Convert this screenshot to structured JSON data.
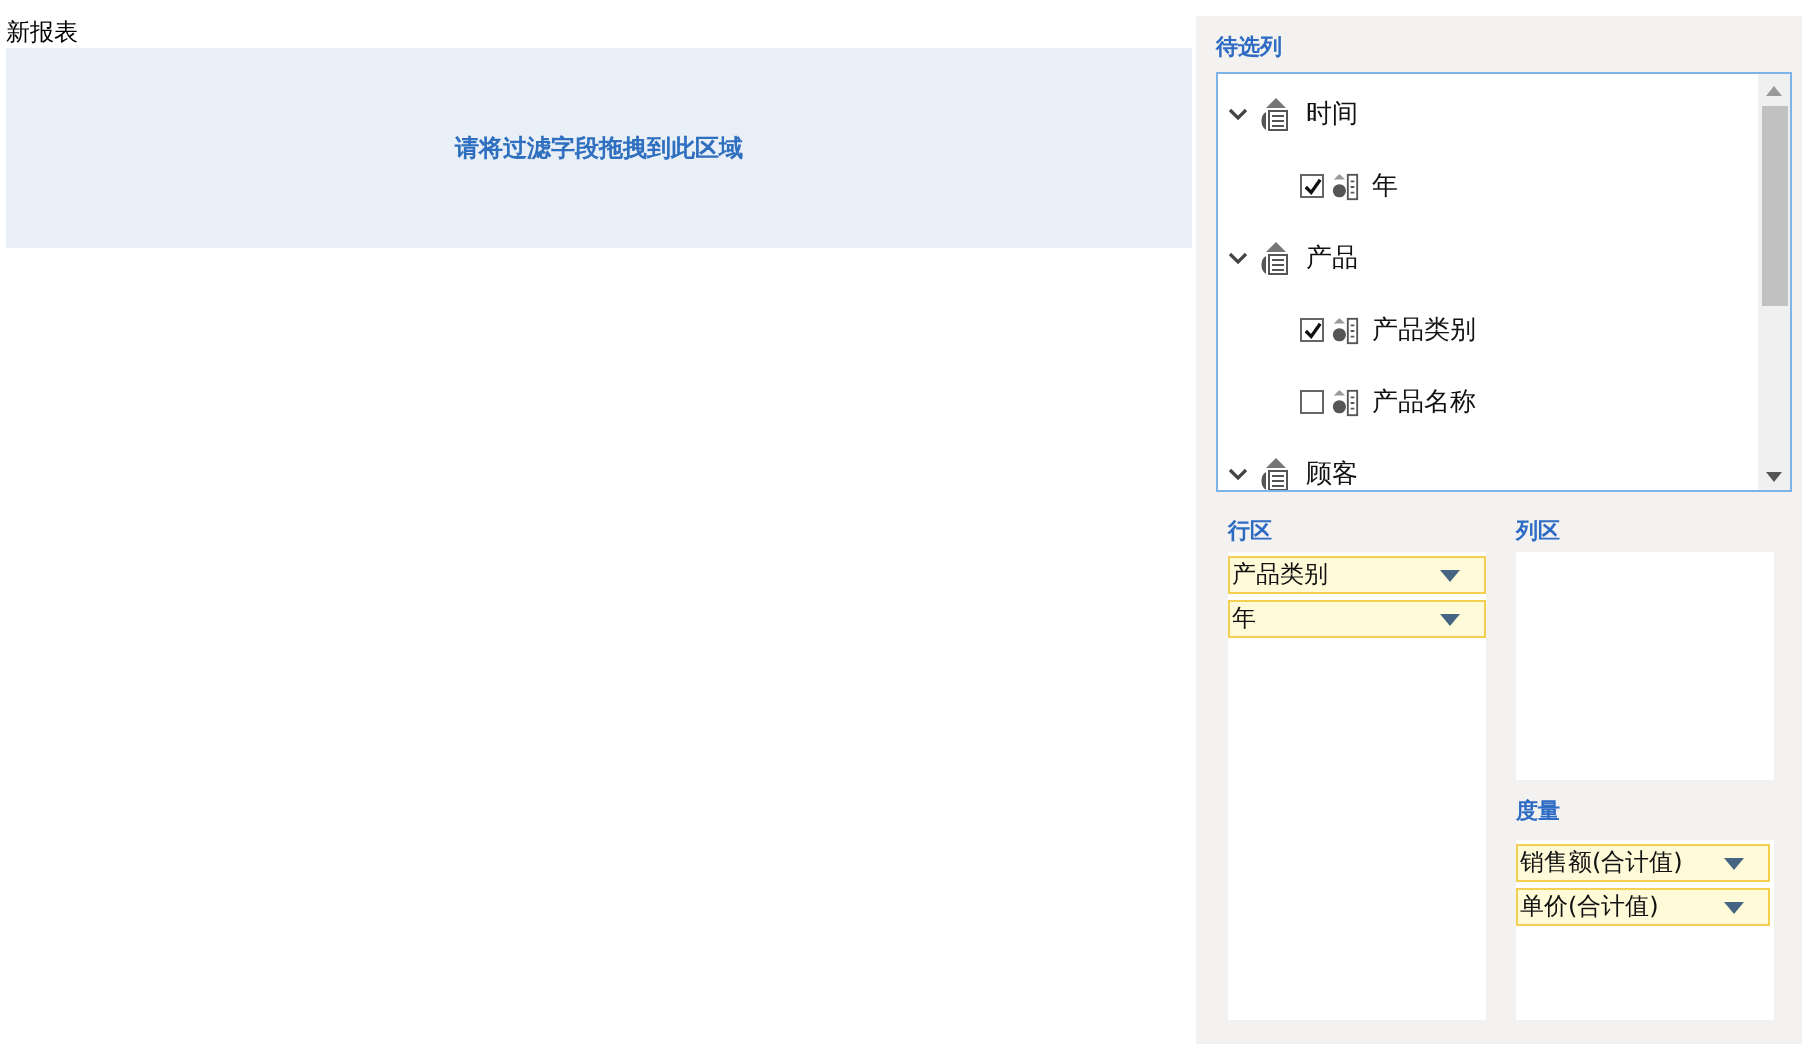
{
  "report": {
    "title": "新报表",
    "filter_hint": "请将过滤字段拖拽到此区域"
  },
  "field_list": {
    "title": "待选列",
    "items": [
      {
        "label": "时间",
        "expanded": true,
        "children": [
          {
            "label": "年",
            "checked": true
          }
        ]
      },
      {
        "label": "产品",
        "expanded": true,
        "children": [
          {
            "label": "产品类别",
            "checked": true
          },
          {
            "label": "产品名称",
            "checked": false
          }
        ]
      },
      {
        "label": "顾客",
        "expanded": true
      }
    ]
  },
  "row_area": {
    "title": "行区",
    "fields": [
      "产品类别",
      "年"
    ]
  },
  "column_area": {
    "title": "列区"
  },
  "measures": {
    "title": "度量",
    "fields": [
      "销售额(合计值)",
      "单价(合计值)"
    ]
  }
}
